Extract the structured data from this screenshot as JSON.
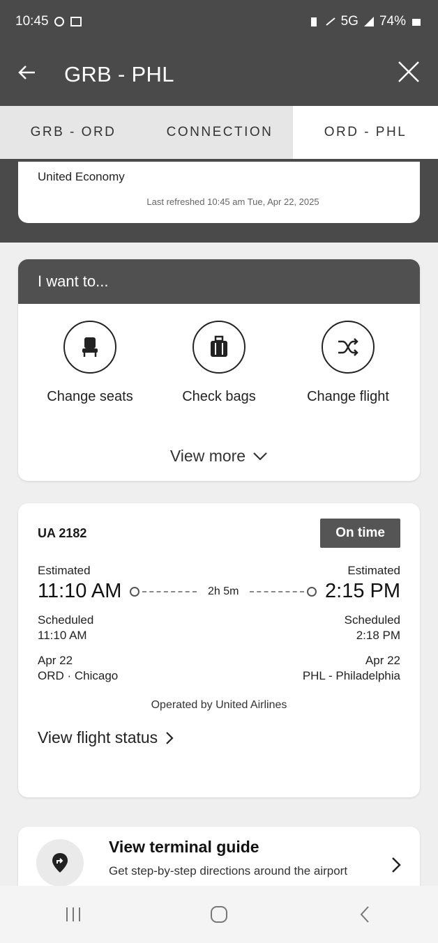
{
  "status_bar": {
    "time": "10:45",
    "network": "5G",
    "battery": "74%"
  },
  "header": {
    "title": "GRB - PHL",
    "back_icon": "arrow-left-icon",
    "close_icon": "close-icon"
  },
  "tabs": [
    {
      "label": "GRB - ORD",
      "selected": false
    },
    {
      "label": "CONNECTION",
      "selected": false
    },
    {
      "label": "ORD - PHL",
      "selected": true
    }
  ],
  "info": {
    "cabin": "United Economy",
    "refreshed": "Last refreshed 10:45 am Tue, Apr 22, 2025"
  },
  "want": {
    "heading": "I want to...",
    "actions": [
      {
        "label": "Change seats",
        "icon": "seat-icon"
      },
      {
        "label": "Check bags",
        "icon": "bag-icon"
      },
      {
        "label": "Change flight",
        "icon": "shuffle-icon"
      }
    ],
    "view_more": "View more"
  },
  "flight": {
    "number": "UA 2182",
    "status": "On time",
    "depart": {
      "estimated_label": "Estimated",
      "estimated_time": "11:10 AM",
      "scheduled_label": "Scheduled",
      "scheduled_time": "11:10 AM",
      "date": "Apr 22",
      "airport": "ORD · Chicago"
    },
    "arrive": {
      "estimated_label": "Estimated",
      "estimated_time": "2:15 PM",
      "scheduled_label": "Scheduled",
      "scheduled_time": "2:18 PM",
      "date": "Apr 22",
      "airport": "PHL - Philadelphia"
    },
    "duration": "2h 5m",
    "operated_by": "Operated by United Airlines",
    "status_link": "View flight status"
  },
  "terminal": {
    "title": "View terminal guide",
    "subtitle": "Get step-by-step directions around the airport"
  },
  "colors": {
    "header_bg": "#4a4a4a",
    "badge_bg": "#555555"
  }
}
